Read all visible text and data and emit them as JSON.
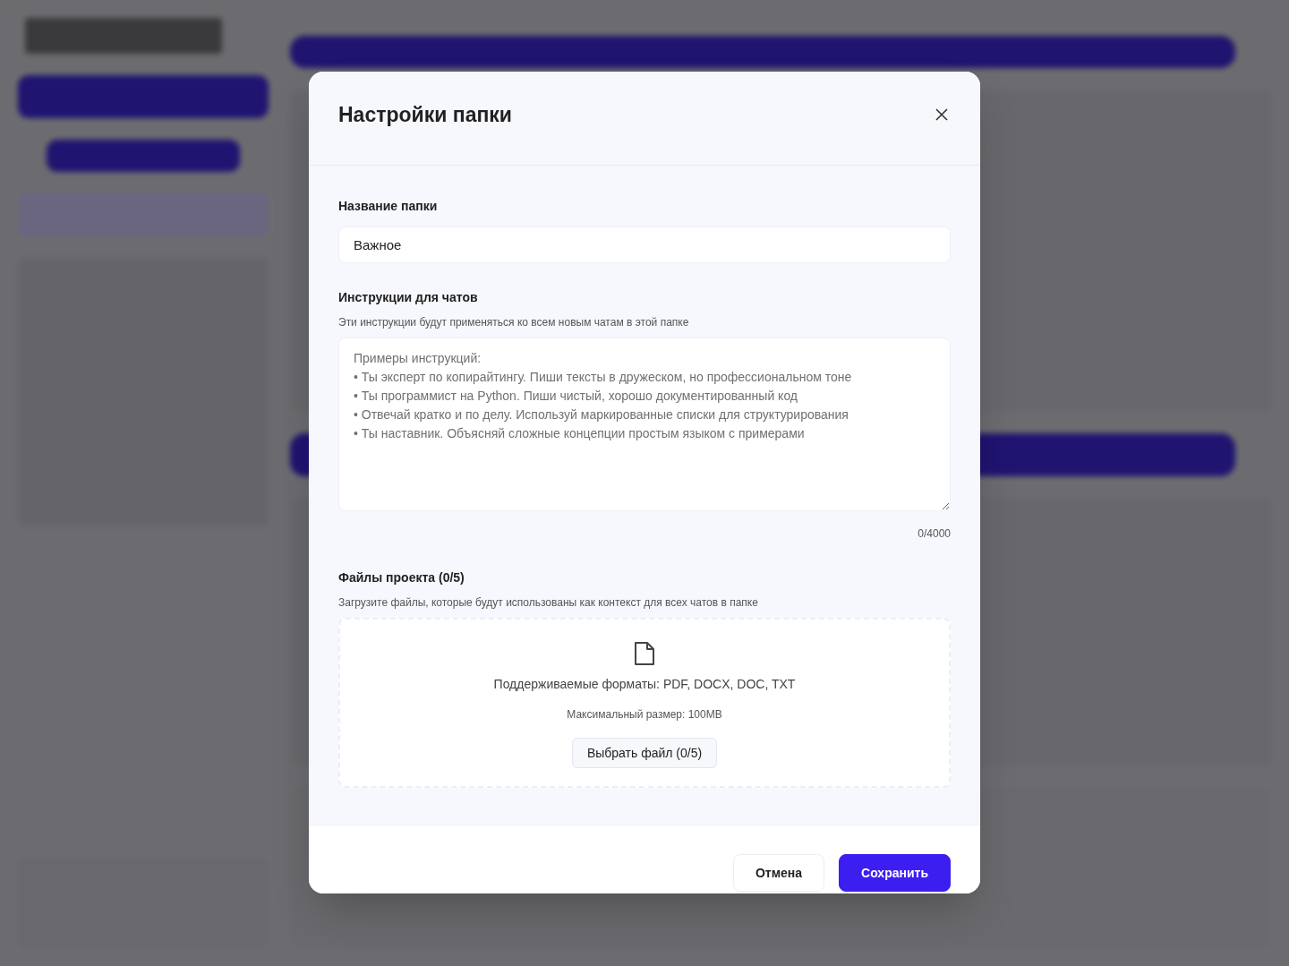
{
  "dialog": {
    "title": "Настройки папки",
    "name_field": {
      "label": "Название папки",
      "value": "Важное"
    },
    "instructions": {
      "label": "Инструкции для чатов",
      "hint": "Эти инструкции будут применяться ко всем новым чатам в этой папке",
      "placeholder": "Примеры инструкций:\n• Ты эксперт по копирайтингу. Пиши тексты в дружеском, но профессиональном тоне\n• Ты программист на Python. Пиши чистый, хорошо документированный код\n• Отвечай кратко и по делу. Используй маркированные списки для структурирования\n• Ты наставник. Объясняй сложные концепции простым языком с примерами",
      "counter": "0/4000"
    },
    "files": {
      "label": "Файлы проекта (0/5)",
      "hint": "Загрузите файлы, которые будут использованы как контекст для всех чатов в папке",
      "formats": "Поддерживаемые форматы: PDF, DOCX, DOC, TXT",
      "max_size": "Максимальный размер: 100MB",
      "choose_button": "Выбрать файл (0/5)"
    },
    "buttons": [
      {
        "label": "Отмена",
        "kind": "secondary"
      },
      {
        "label": "Сохранить",
        "kind": "primary"
      }
    ]
  }
}
